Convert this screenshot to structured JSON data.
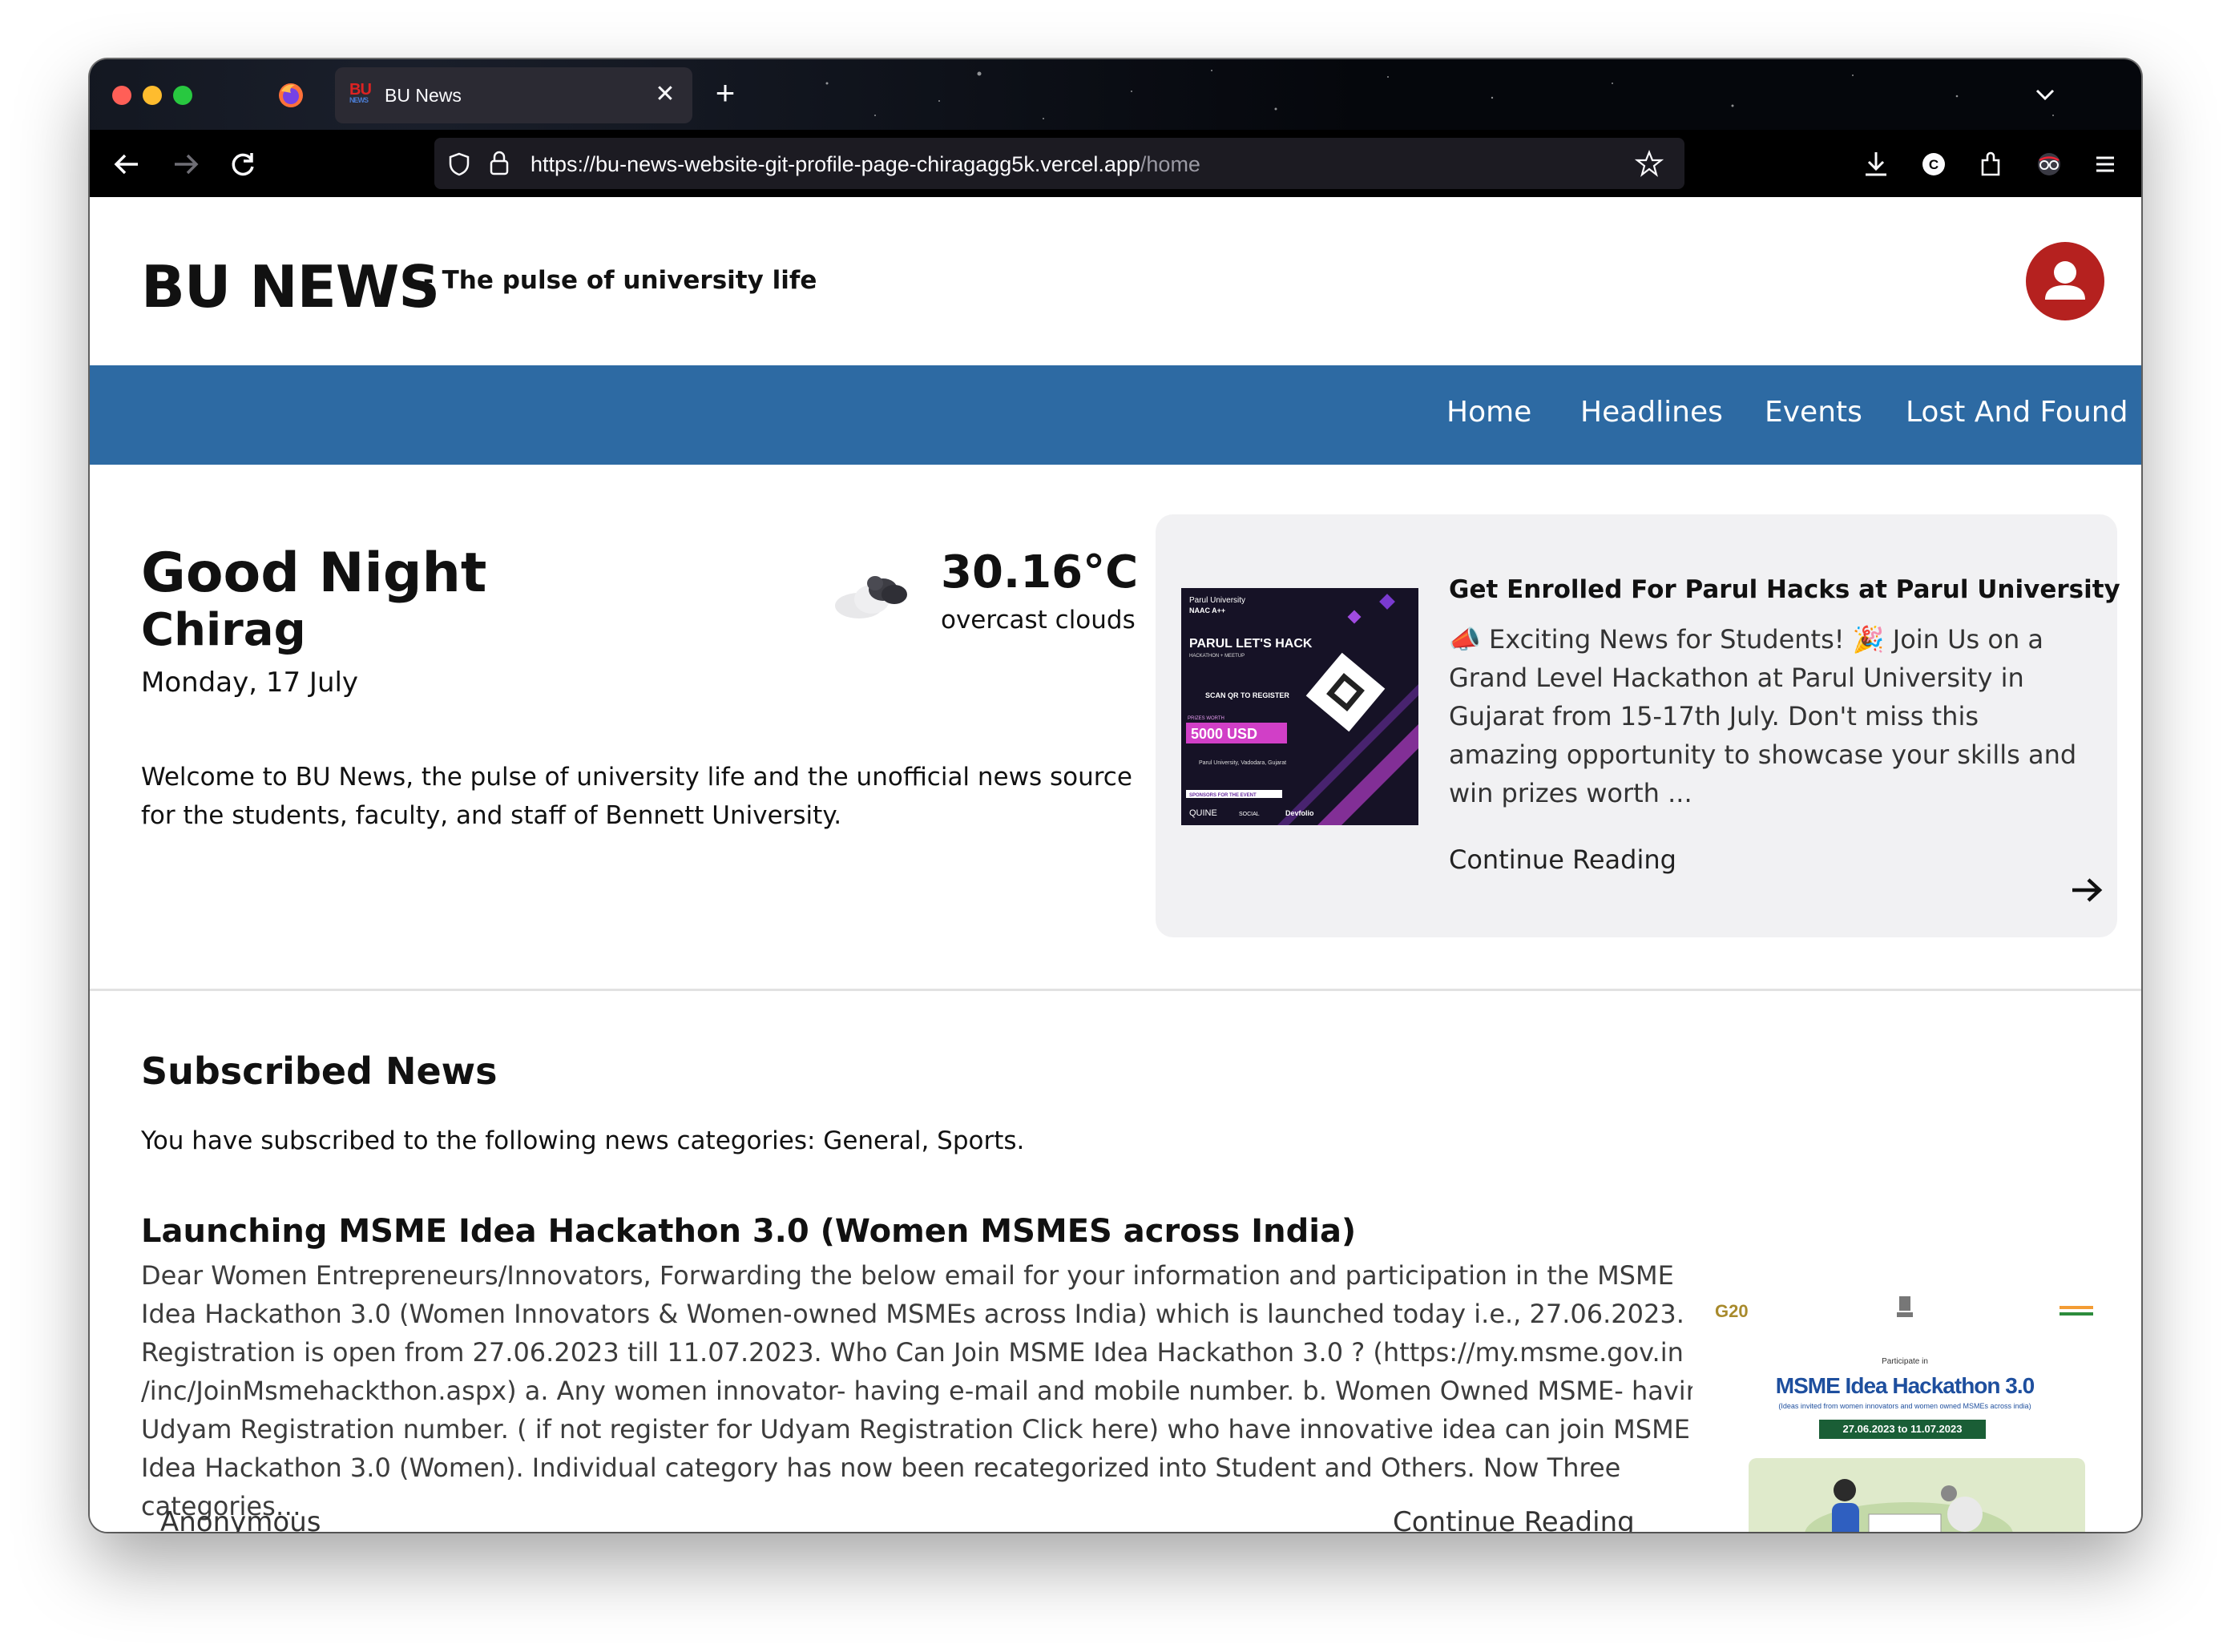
{
  "browser": {
    "tab_title": "BU News",
    "tab_favicon_text": "BU",
    "tab_favicon_sub": "NEWS",
    "new_tab_label": "+",
    "close_tab_label": "✕",
    "url_host": "https://bu-news-website-git-profile-page-chiragagg5k.vercel.app",
    "url_path": "/home"
  },
  "site": {
    "logo": "BU NEWS",
    "tagline": "- The pulse of university life",
    "menu": [
      "Home",
      "Headlines",
      "Events",
      "Lost And Found"
    ]
  },
  "greeting": {
    "title": "Good Night",
    "name": "Chirag",
    "date": "Monday, 17 July",
    "temperature": "30.16°C",
    "condition": "overcast clouds",
    "welcome": "Welcome to BU News, the pulse of university life and the unofficial news source for the students, faculty, and staff of Bennett University."
  },
  "featured": {
    "title": "Get Enrolled For Parul Hacks at Parul University",
    "body": "📣 Exciting News for Students! 🎉 Join Us on a Grand Level Hackathon at Parul University in Gujarat from 15-17th July. Don't miss this amazing opportunity to showcase your skills and win prizes worth ...",
    "more": "Continue Reading",
    "image": {
      "brand": "Parul University",
      "naac": "NAAC A++",
      "heading": "PARUL LET'S HACK",
      "subheading": "HACKATHON + MEETUP",
      "scan": "SCAN QR TO REGISTER",
      "prize_label": "PRIZES WORTH",
      "prize": "5000 USD",
      "location": "Parul University, Vadodara, Gujarat",
      "sponsors_label": "SPONSORS FOR THE EVENT",
      "sponsors": [
        "QUINE",
        "SOCIAL",
        "Devfolio"
      ]
    }
  },
  "subscribed": {
    "title": "Subscribed News",
    "text": "You have subscribed to the following news categories: General, Sports."
  },
  "article": {
    "title": "Launching MSME Idea Hackathon 3.0 (Women MSMES across India)",
    "body": "Dear Women Entrepreneurs/Innovators, Forwarding the below email for your information and participation in the MSME Idea Hackathon 3.0 (Women Innovators & Women-owned MSMEs across India) which is launched today i.e., 27.06.2023. Registration is open from 27.06.2023 till 11.07.2023. Who Can Join MSME Idea Hackathon 3.0 ? (https://my.msme.gov.in /inc/JoinMsmehackthon.aspx) a. Any women innovator- having e-mail and mobile number. b. Women Owned MSME- having Udyam Registration number. ( if not register for Udyam Registration Click here)       who have innovative idea can join MSME Idea Hackathon 3.0 (Women).       Individual category has now been recategorized into Student and Others. Now Three categories…",
    "author": "Anonymous",
    "more": "Continue Reading",
    "image": {
      "g20": "G20",
      "header": "Participate in",
      "title": "MSME Idea Hackathon 3.0",
      "subtitle": "(Ideas invited from women innovators and women owned MSMEs across india)",
      "dates": "27.06.2023 to 11.07.2023"
    }
  },
  "colors": {
    "menu_bar": "#2d6aa3",
    "avatar": "#b5211f",
    "featured_bg": "#f1f1f3"
  }
}
